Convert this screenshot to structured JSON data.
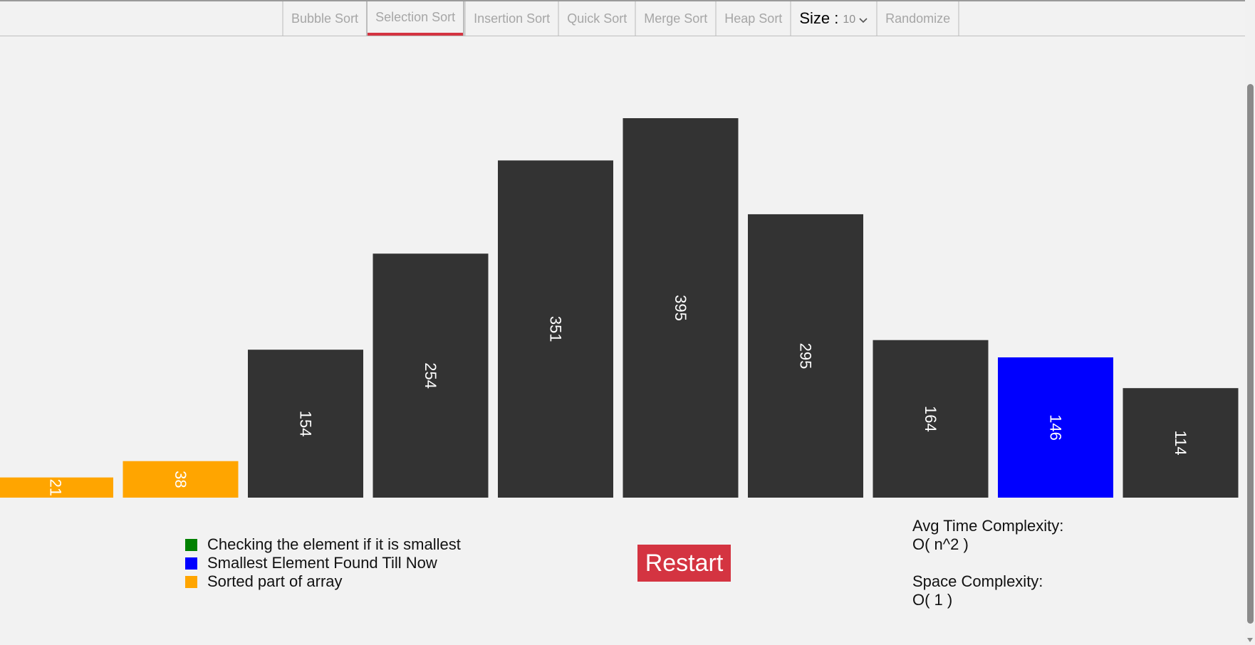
{
  "nav": {
    "items": [
      "Bubble Sort",
      "Selection Sort",
      "Insertion Sort",
      "Quick Sort",
      "Merge Sort",
      "Heap Sort"
    ],
    "active_index": 1,
    "size_label": "Size :",
    "size_value": "10",
    "randomize_label": "Randomize"
  },
  "colors": {
    "checking": "#008000",
    "smallest": "#0000ff",
    "sorted": "#ffa500",
    "default": "#333333",
    "accent": "#d43441"
  },
  "chart_data": {
    "type": "bar",
    "values": [
      21,
      38,
      154,
      254,
      351,
      395,
      295,
      164,
      146,
      114
    ],
    "bar_states": [
      "sorted",
      "sorted",
      "default",
      "default",
      "default",
      "default",
      "default",
      "default",
      "smallest",
      "default"
    ],
    "ylim": [
      0,
      395
    ]
  },
  "legend": {
    "items": [
      {
        "label": "Checking the element if it is smallest",
        "color": "#008000"
      },
      {
        "label": "Smallest Element Found Till Now",
        "color": "#0000ff"
      },
      {
        "label": "Sorted part of array",
        "color": "#ffa500"
      }
    ]
  },
  "restart_label": "Restart",
  "complexity": {
    "time_label": "Avg Time Complexity:",
    "time_value": "O( n^2 )",
    "space_label": "Space Complexity:",
    "space_value": "O( 1 )"
  }
}
